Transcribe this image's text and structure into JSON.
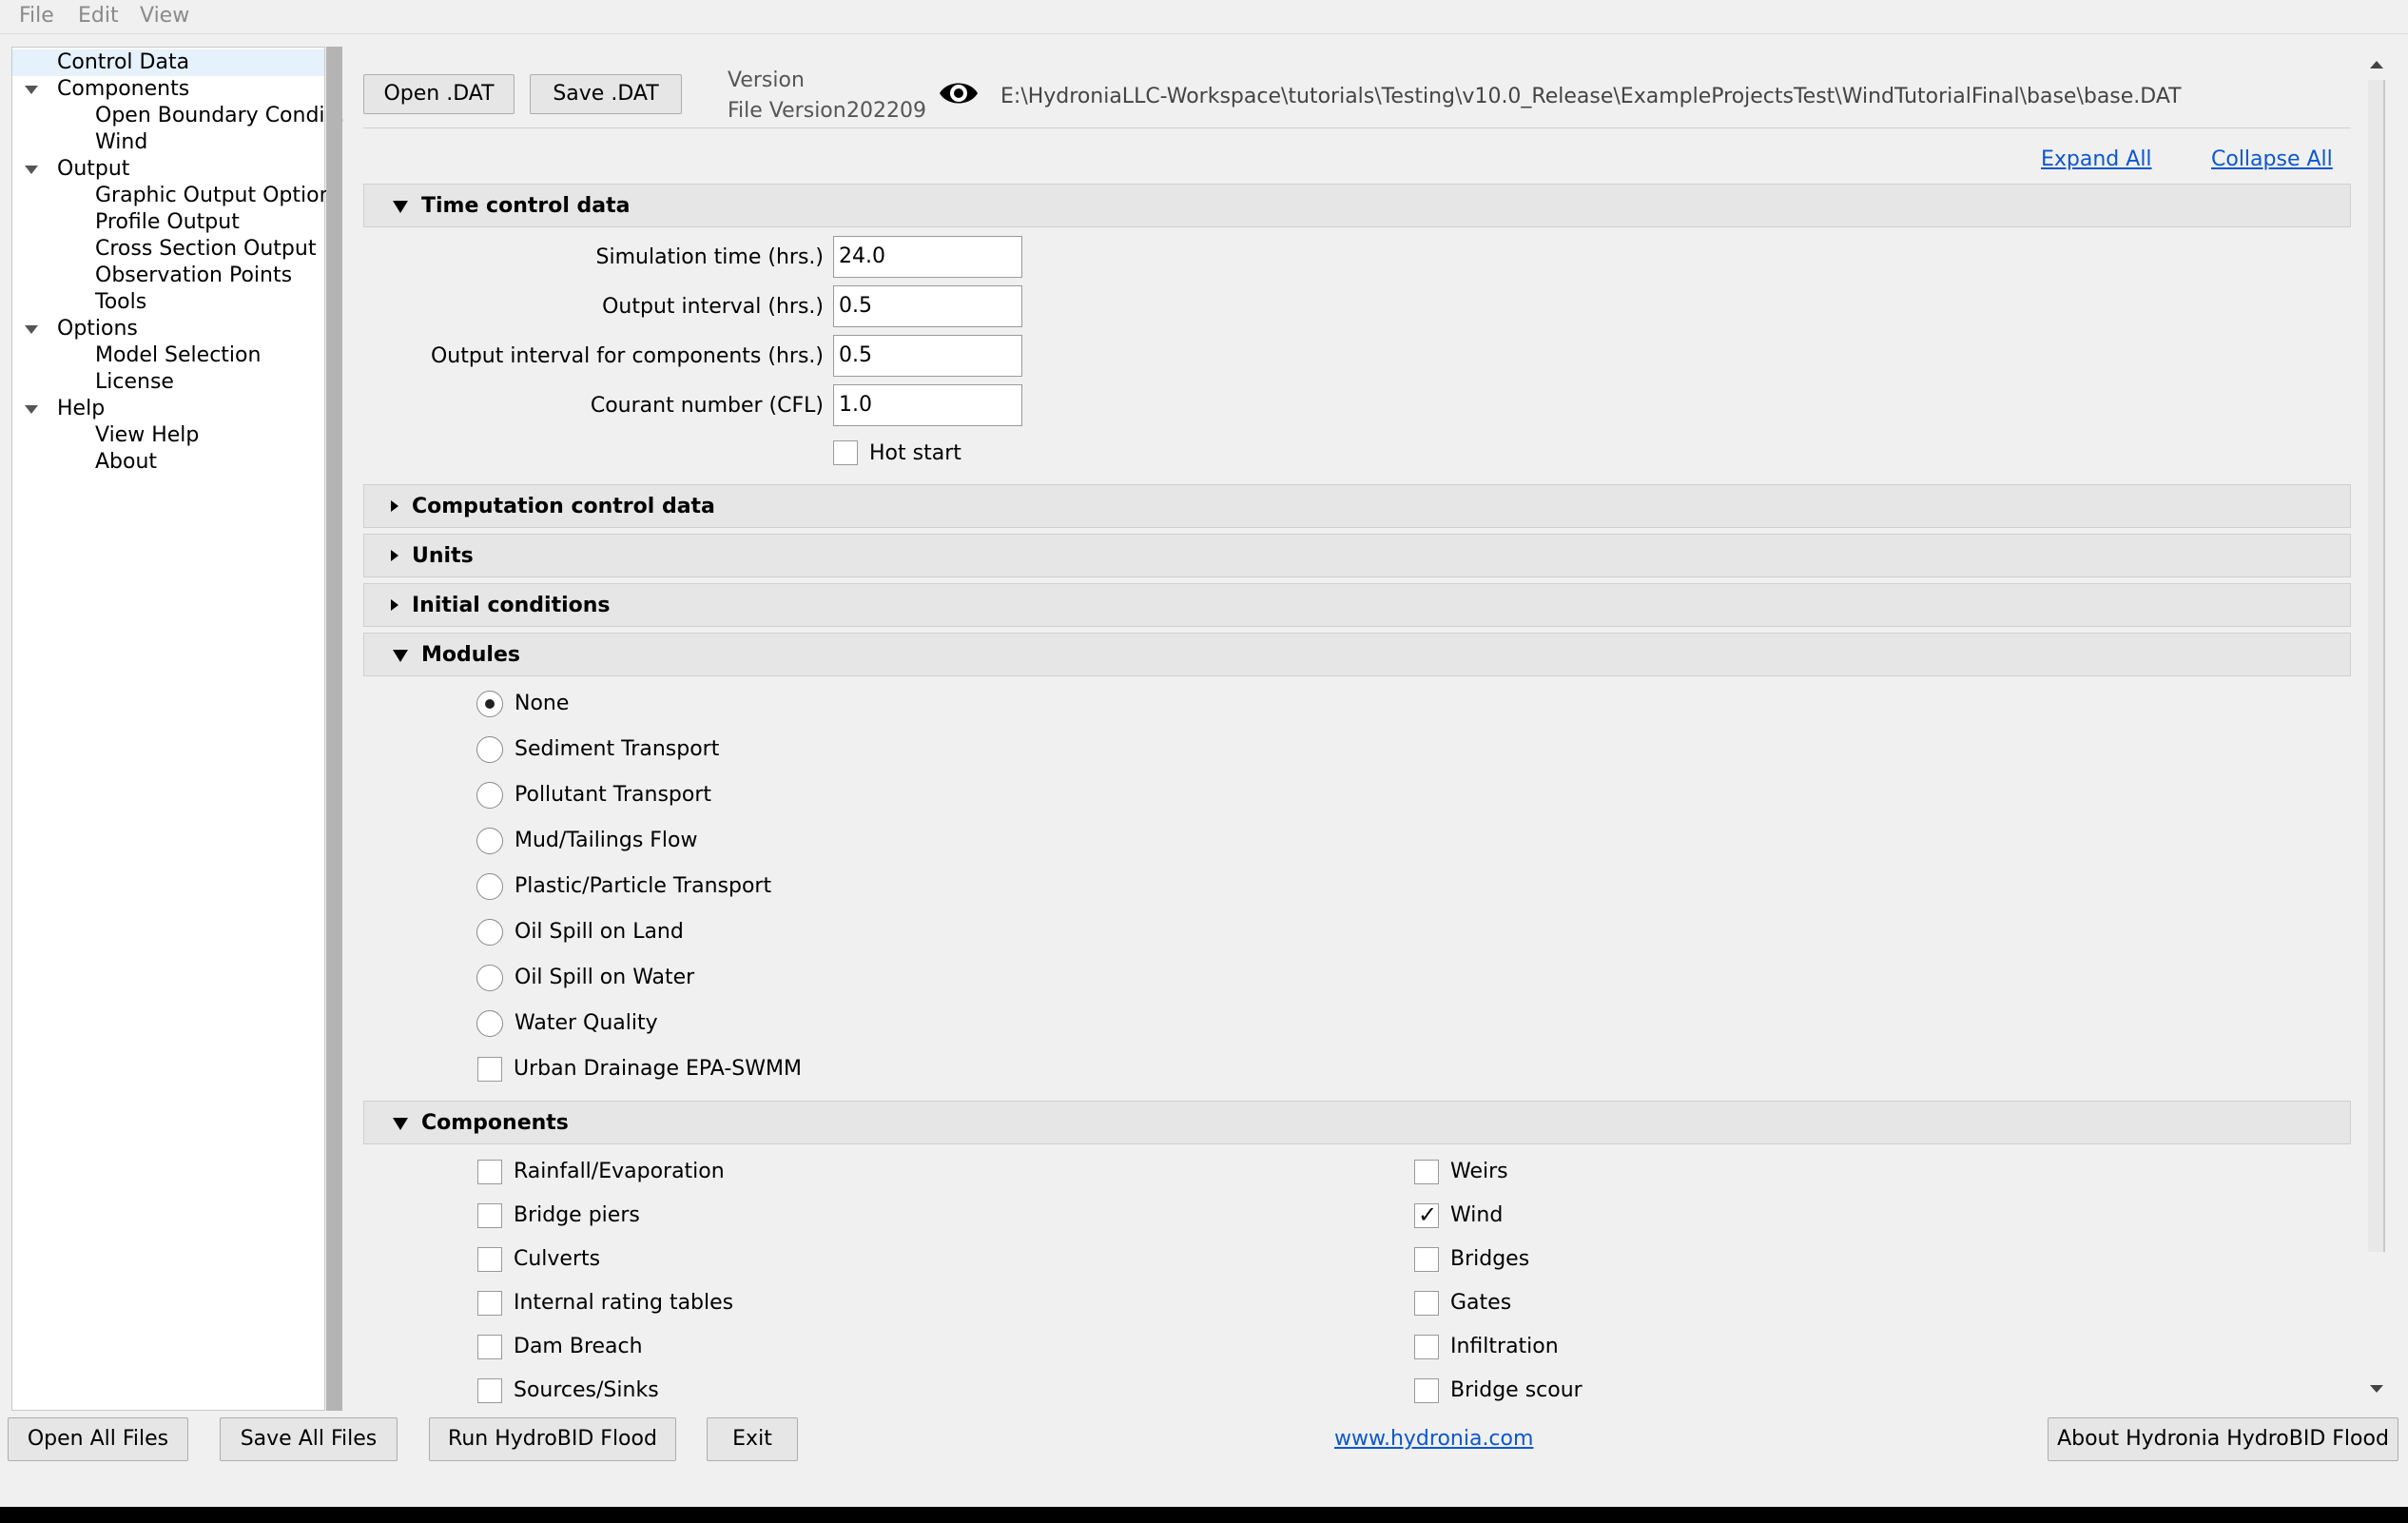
{
  "menu": [
    "File",
    "Edit",
    "View"
  ],
  "tree": [
    {
      "label": "Control Data",
      "level": 0,
      "expanded": null,
      "selected": true
    },
    {
      "label": "Components",
      "level": 0,
      "expanded": true
    },
    {
      "label": "Open Boundary Condi...",
      "level": 1
    },
    {
      "label": "Wind",
      "level": 1
    },
    {
      "label": "Output",
      "level": 0,
      "expanded": true
    },
    {
      "label": "Graphic Output Options",
      "level": 1
    },
    {
      "label": "Profile Output",
      "level": 1
    },
    {
      "label": "Cross Section Output",
      "level": 1
    },
    {
      "label": "Observation Points",
      "level": 1
    },
    {
      "label": "Tools",
      "level": 1
    },
    {
      "label": "Options",
      "level": 0,
      "expanded": true
    },
    {
      "label": "Model Selection",
      "level": 1
    },
    {
      "label": "License",
      "level": 1
    },
    {
      "label": "Help",
      "level": 0,
      "expanded": true
    },
    {
      "label": "View Help",
      "level": 1
    },
    {
      "label": "About",
      "level": 1
    }
  ],
  "toolbar": {
    "open_dat": "Open .DAT",
    "save_dat": "Save .DAT",
    "version_label": "Version",
    "file_version_label": "File Version",
    "file_version_value": "202209",
    "file_path": "E:\\HydroniaLLC-Workspace\\tutorials\\Testing\\v10.0_Release\\ExampleProjectsTest\\WindTutorialFinal\\base\\base.DAT",
    "expand_all": "Expand All",
    "collapse_all": "Collapse All"
  },
  "sections": {
    "time_control": "Time control data",
    "computation": "Computation control data",
    "units": "Units",
    "initial": "Initial conditions",
    "modules": "Modules",
    "components": "Components"
  },
  "time_control": {
    "fields": [
      {
        "label": "Simulation time (hrs.)",
        "value": "24.0"
      },
      {
        "label": "Output interval (hrs.)",
        "value": "0.5"
      },
      {
        "label": "Output interval for components (hrs.)",
        "value": "0.5"
      },
      {
        "label": "Courant number (CFL)",
        "value": "1.0"
      }
    ],
    "hot_start": {
      "label": "Hot start",
      "checked": false
    }
  },
  "modules": {
    "options": [
      "None",
      "Sediment Transport",
      "Pollutant Transport",
      "Mud/Tailings Flow",
      "Plastic/Particle Transport",
      "Oil Spill on Land",
      "Oil Spill on Water",
      "Water Quality"
    ],
    "selected": "None",
    "swmm": {
      "label": "Urban Drainage EPA-SWMM",
      "checked": false
    }
  },
  "components": {
    "left": [
      {
        "label": "Rainfall/Evaporation",
        "checked": false
      },
      {
        "label": "Bridge piers",
        "checked": false
      },
      {
        "label": "Culverts",
        "checked": false
      },
      {
        "label": "Internal rating tables",
        "checked": false
      },
      {
        "label": "Dam Breach",
        "checked": false
      },
      {
        "label": "Sources/Sinks",
        "checked": false
      }
    ],
    "right": [
      {
        "label": "Weirs",
        "checked": false
      },
      {
        "label": "Wind",
        "checked": true
      },
      {
        "label": "Bridges",
        "checked": false
      },
      {
        "label": "Gates",
        "checked": false
      },
      {
        "label": "Infiltration",
        "checked": false
      },
      {
        "label": "Bridge scour",
        "checked": false
      }
    ]
  },
  "footer": {
    "open_all": "Open All Files",
    "save_all": "Save All Files",
    "run": "Run HydroBID Flood",
    "exit": "Exit",
    "website": "www.hydronia.com",
    "about": "About Hydronia HydroBID Flood"
  },
  "icons": {
    "file_visibility": "eye-icon"
  },
  "colors": {
    "link": "#0b57d0",
    "section_bg": "#e6e6e6",
    "selection": "#e5f1fb"
  }
}
